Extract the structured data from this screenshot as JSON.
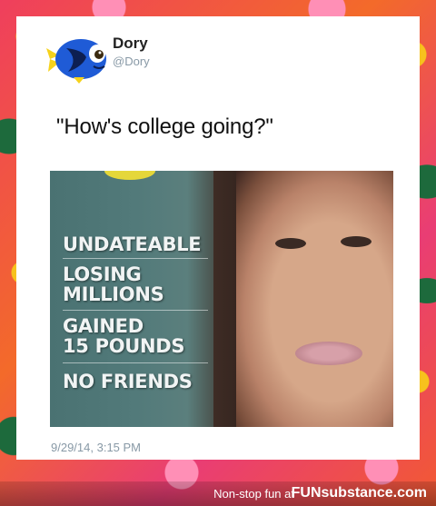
{
  "tweet": {
    "display_name": "Dory",
    "handle": "@Dory",
    "text": "\"How's college going?\"",
    "timestamp": "9/29/14, 3:15 PM",
    "avatar_icon": "dory-fish-icon"
  },
  "photo": {
    "headlines": [
      "UNDATEABLE",
      "LOSING",
      "MILLIONS",
      "GAINED",
      "15 POUNDS",
      "NO FRIENDS"
    ]
  },
  "footer": {
    "tagline": "Non-stop fun at",
    "brand": "FUNsubstance.com"
  },
  "colors": {
    "card_bg": "#ffffff",
    "handle_gray": "#8899a6",
    "dory_blue": "#1f5bd6",
    "dory_yellow": "#f6d21c"
  }
}
